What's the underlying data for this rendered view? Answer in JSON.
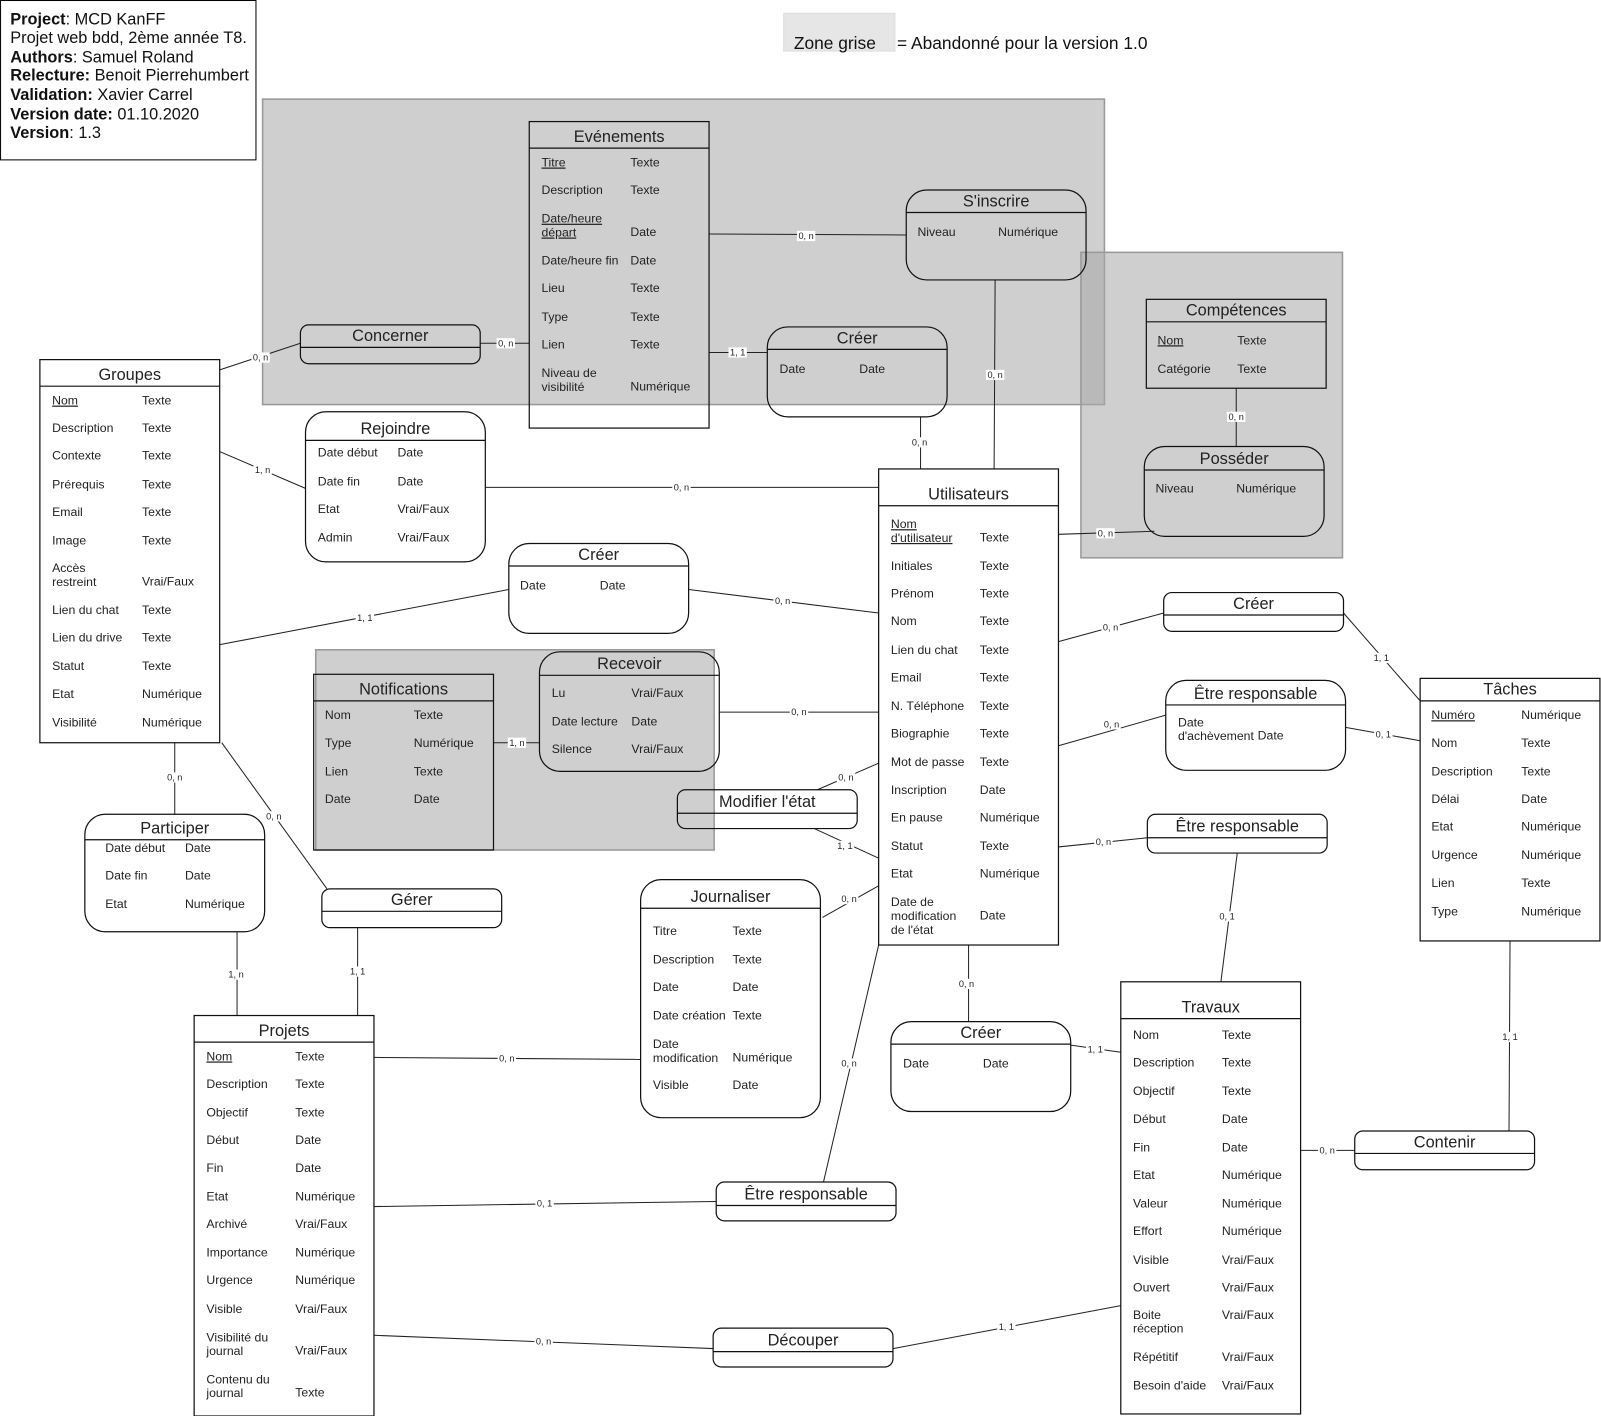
{
  "header_box": {
    "lines": [
      {
        "label": "Project",
        "value": ": MCD KanFF"
      },
      {
        "label": "",
        "value": "Projet web bdd, 2ème année T8."
      },
      {
        "label": "Authors",
        "value": ": Samuel Roland"
      },
      {
        "label": "Relecture:",
        "value": " Benoit Pierrehumbert"
      },
      {
        "label": "Validation:",
        "value": " Xavier Carrel"
      },
      {
        "label": "Version date:",
        "value": " 01.10.2020"
      },
      {
        "label": "Version",
        "value": ": 1.3"
      }
    ]
  },
  "legend": {
    "swatch_label": "Zone grise",
    "text": "= Abandonné pour la version 1.0",
    "zone_color": "#cccccc"
  },
  "entities": [
    {
      "title": "Evénements",
      "attributes": [
        {
          "name": "Titre",
          "type": "Texte",
          "key": true
        },
        {
          "name": "Description",
          "type": "Texte"
        },
        {
          "name": "Date/heure\ndépart",
          "type": "Date",
          "key": true
        },
        {
          "name": "Date/heure fin",
          "type": "Date"
        },
        {
          "name": "Lieu",
          "type": "Texte"
        },
        {
          "name": "Type",
          "type": "Texte"
        },
        {
          "name": "Lien",
          "type": "Texte"
        },
        {
          "name": "Niveau de\nvisibilité",
          "type": "Numérique"
        }
      ]
    },
    {
      "title": "Groupes",
      "attributes": [
        {
          "name": "Nom",
          "type": "Texte",
          "key": true
        },
        {
          "name": "Description",
          "type": "Texte"
        },
        {
          "name": "Contexte",
          "type": "Texte"
        },
        {
          "name": "Prérequis",
          "type": "Texte"
        },
        {
          "name": "Email",
          "type": "Texte"
        },
        {
          "name": "Image",
          "type": "Texte"
        },
        {
          "name": "Accès\nrestreint",
          "type": "Vrai/Faux"
        },
        {
          "name": "Lien du chat",
          "type": "Texte"
        },
        {
          "name": "Lien du drive",
          "type": "Texte"
        },
        {
          "name": "Statut",
          "type": "Texte"
        },
        {
          "name": "Etat",
          "type": "Numérique"
        },
        {
          "name": "Visibilité",
          "type": "Numérique"
        }
      ]
    },
    {
      "title": "Compétences",
      "attributes": [
        {
          "name": "Nom",
          "type": "Texte",
          "key": true
        },
        {
          "name": "Catégorie",
          "type": "Texte"
        }
      ]
    },
    {
      "title": "Utilisateurs",
      "attributes": [
        {
          "name": "Nom\nd'utilisateur",
          "type": "Texte",
          "key": true
        },
        {
          "name": "Initiales",
          "type": "Texte"
        },
        {
          "name": "Prénom",
          "type": "Texte"
        },
        {
          "name": "Nom",
          "type": "Texte"
        },
        {
          "name": "Lien du chat",
          "type": "Texte"
        },
        {
          "name": "Email",
          "type": "Texte"
        },
        {
          "name": "N. Téléphone",
          "type": "Texte"
        },
        {
          "name": "Biographie",
          "type": "Texte"
        },
        {
          "name": "Mot de passe",
          "type": "Texte"
        },
        {
          "name": "Inscription",
          "type": "Date"
        },
        {
          "name": "En pause",
          "type": "Numérique"
        },
        {
          "name": "Statut",
          "type": "Texte"
        },
        {
          "name": "Etat",
          "type": "Numérique"
        },
        {
          "name": "Date de\nmodification\nde l'état",
          "type": "Date"
        }
      ]
    },
    {
      "title": "Notifications",
      "attributes": [
        {
          "name": "Nom",
          "type": "Texte"
        },
        {
          "name": "Type",
          "type": "Numérique"
        },
        {
          "name": "Lien",
          "type": "Texte"
        },
        {
          "name": "Date",
          "type": "Date"
        }
      ]
    },
    {
      "title": "Tâches",
      "attributes": [
        {
          "name": "Numéro",
          "type": "Numérique",
          "key": true
        },
        {
          "name": "Nom",
          "type": "Texte"
        },
        {
          "name": "Description",
          "type": "Texte"
        },
        {
          "name": "Délai",
          "type": "Date"
        },
        {
          "name": "Etat",
          "type": "Numérique"
        },
        {
          "name": "Urgence",
          "type": "Numérique"
        },
        {
          "name": "Lien",
          "type": "Texte"
        },
        {
          "name": "Type",
          "type": "Numérique"
        }
      ]
    },
    {
      "title": "Projets",
      "attributes": [
        {
          "name": "Nom",
          "type": "Texte",
          "key": true
        },
        {
          "name": "Description",
          "type": "Texte"
        },
        {
          "name": "Objectif",
          "type": "Texte"
        },
        {
          "name": "Début",
          "type": "Date"
        },
        {
          "name": "Fin",
          "type": "Date"
        },
        {
          "name": "Etat",
          "type": "Numérique"
        },
        {
          "name": "Archivé",
          "type": "Vrai/Faux"
        },
        {
          "name": "Importance",
          "type": "Numérique"
        },
        {
          "name": "Urgence",
          "type": "Numérique"
        },
        {
          "name": "Visible",
          "type": "Vrai/Faux"
        },
        {
          "name": "Visibilité du\njournal",
          "type": "Vrai/Faux"
        },
        {
          "name": "Contenu du\njournal",
          "type": "Texte"
        }
      ]
    },
    {
      "title": "Travaux",
      "attributes": [
        {
          "name": "Nom",
          "type": "Texte"
        },
        {
          "name": "Description",
          "type": "Texte"
        },
        {
          "name": "Objectif",
          "type": "Texte"
        },
        {
          "name": "Début",
          "type": "Date"
        },
        {
          "name": "Fin",
          "type": "Date"
        },
        {
          "name": "Etat",
          "type": "Numérique"
        },
        {
          "name": "Valeur",
          "type": "Numérique"
        },
        {
          "name": "Effort",
          "type": "Numérique"
        },
        {
          "name": "Visible",
          "type": "Vrai/Faux"
        },
        {
          "name": "Ouvert",
          "type": "Vrai/Faux"
        },
        {
          "name": "Boite\nréception",
          "type": "Vrai/Faux"
        },
        {
          "name": "Répétitif",
          "type": "Vrai/Faux"
        },
        {
          "name": "Besoin d'aide",
          "type": "Vrai/Faux"
        }
      ]
    }
  ],
  "associations": [
    {
      "title": "S'inscrire",
      "attributes": [
        {
          "name": "Niveau",
          "type": "Numérique"
        }
      ]
    },
    {
      "title": "Concerner",
      "attributes": []
    },
    {
      "title": "Créer",
      "attributes": [
        {
          "name": "Date",
          "type": "Date"
        }
      ]
    },
    {
      "title": "Posséder",
      "attributes": [
        {
          "name": "Niveau",
          "type": "Numérique"
        }
      ]
    },
    {
      "title": "Rejoindre",
      "attributes": [
        {
          "name": "Date début",
          "type": "Date"
        },
        {
          "name": "Date fin",
          "type": "Date"
        },
        {
          "name": "Etat",
          "type": "Vrai/Faux"
        },
        {
          "name": "Admin",
          "type": "Vrai/Faux"
        }
      ]
    },
    {
      "title": "Créer",
      "attributes": [
        {
          "name": "Date",
          "type": "Date"
        }
      ]
    },
    {
      "title": "Recevoir",
      "attributes": [
        {
          "name": "Lu",
          "type": "Vrai/Faux"
        },
        {
          "name": "Date lecture",
          "type": "Date"
        },
        {
          "name": "Silence",
          "type": "Vrai/Faux"
        }
      ]
    },
    {
      "title": "Modifier l'état",
      "attributes": []
    },
    {
      "title": "Participer",
      "attributes": [
        {
          "name": "Date début",
          "type": "Date"
        },
        {
          "name": "Date fin",
          "type": "Date"
        },
        {
          "name": "Etat",
          "type": "Numérique"
        }
      ]
    },
    {
      "title": "Gérer",
      "attributes": []
    },
    {
      "title": "Journaliser",
      "attributes": [
        {
          "name": "Titre",
          "type": "Texte"
        },
        {
          "name": "Description",
          "type": "Texte"
        },
        {
          "name": "Date",
          "type": "Date"
        },
        {
          "name": "Date création",
          "type": "Texte"
        },
        {
          "name": "Date\nmodification",
          "type": "Numérique"
        },
        {
          "name": "Visible",
          "type": "Date"
        }
      ]
    },
    {
      "title": "Créer",
      "attributes": []
    },
    {
      "title": "Être responsable",
      "attributes": [
        {
          "name": "Date\nd'achèvement",
          "type": "Date"
        }
      ]
    },
    {
      "title": "Être responsable",
      "attributes": []
    },
    {
      "title": "Créer",
      "attributes": [
        {
          "name": "Date",
          "type": "Date"
        }
      ]
    },
    {
      "title": "Contenir",
      "attributes": []
    },
    {
      "title": "Être responsable",
      "attributes": []
    },
    {
      "title": "Découper",
      "attributes": []
    }
  ],
  "cardinalities": [
    "0, n",
    "0, n",
    "0, n",
    "0, n",
    "1, 1",
    "0, n",
    "0, n",
    "0, n",
    "1, n",
    "0, n",
    "1, 1",
    "0, n",
    "1, n",
    "0, n",
    "0, n",
    "1, 1",
    "0, n",
    "1, n",
    "0, n",
    "1, 1",
    "0, n",
    "0, n",
    "0, 1",
    "0, n",
    "0, n",
    "1, 1",
    "0, n",
    "1, 1",
    "0, n",
    "1, 1",
    "0, n",
    "0, 1",
    "0, n",
    "0, 1",
    "1, 1",
    "0, n"
  ]
}
